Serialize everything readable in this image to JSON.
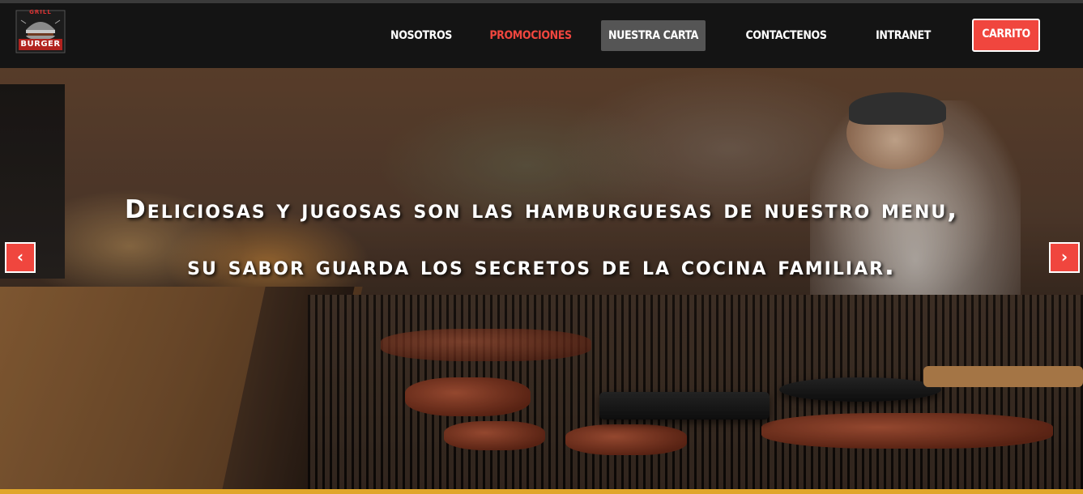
{
  "brand": {
    "logo_top": "GRILL",
    "logo_main": "BURGER"
  },
  "nav": {
    "items": [
      {
        "label": "NOSOTROS"
      },
      {
        "label": "PROMOCIONES"
      },
      {
        "label": "NUESTRA CARTA"
      },
      {
        "label": "CONTACTENOS"
      },
      {
        "label": "INTRANET"
      },
      {
        "label": "CARRITO"
      }
    ]
  },
  "hero": {
    "caption_line1": "Deliciosas y jugosas son las hamburguesas de nuestro menu,",
    "caption_line2": "su sabor guarda los secretos de la cocina familiar.",
    "prev_icon": "chevron-left-icon",
    "next_icon": "chevron-right-icon",
    "prev_glyph": "‹",
    "next_glyph": "›"
  },
  "colors": {
    "accent": "#f0463e",
    "navbar_bg": "#141414",
    "hover_bg": "#555555",
    "bottom_bar": "#e0a62c"
  }
}
